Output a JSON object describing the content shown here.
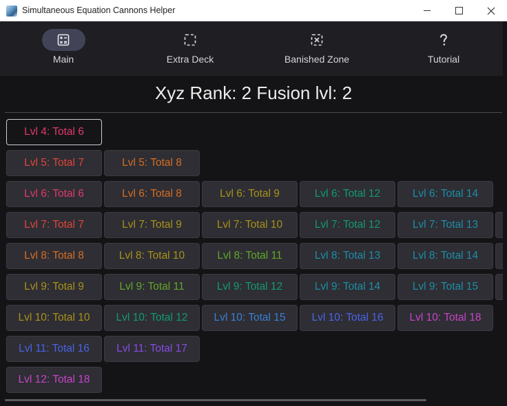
{
  "window": {
    "title": "Simultaneous Equation Cannons Helper"
  },
  "nav": [
    {
      "label": "Main",
      "icon": "calculator-icon"
    },
    {
      "label": "Extra Deck",
      "icon": "dashed-square-icon"
    },
    {
      "label": "Banished Zone",
      "icon": "dashed-square-x-icon"
    },
    {
      "label": "Tutorial",
      "icon": "question-mark-icon"
    }
  ],
  "heading": "Xyz Rank: 2 Fusion lvl: 2",
  "colors": {
    "crimson": "#e03a6a",
    "red": "#e2453a",
    "orange": "#d66e25",
    "olive": "#a9911a",
    "green": "#63a62a",
    "teal": "#139a70",
    "cyan": "#1d8ea7",
    "blue": "#3b7fd5",
    "indigo": "#4b63e6",
    "violet": "#8a4be3",
    "magenta": "#c844c8"
  },
  "rows": [
    [
      {
        "text": "Lvl 4: Total 6",
        "color": "#e03a6a",
        "selected": true
      }
    ],
    [
      {
        "text": "Lvl 5: Total 7",
        "color": "#e2453a"
      },
      {
        "text": "Lvl 5: Total 8",
        "color": "#d66e25"
      }
    ],
    [
      {
        "text": "Lvl 6: Total 6",
        "color": "#e03a6a"
      },
      {
        "text": "Lvl 6: Total 8",
        "color": "#d66e25"
      },
      {
        "text": "Lvl 6: Total 9",
        "color": "#a9911a"
      },
      {
        "text": "Lvl 6: Total 12",
        "color": "#139a70"
      },
      {
        "text": "Lvl 6: Total 14",
        "color": "#1d8ea7"
      }
    ],
    [
      {
        "text": "Lvl 7: Total 7",
        "color": "#e2453a"
      },
      {
        "text": "Lvl 7: Total 9",
        "color": "#a9911a"
      },
      {
        "text": "Lvl 7: Total 10",
        "color": "#a9911a"
      },
      {
        "text": "Lvl 7: Total 12",
        "color": "#139a70"
      },
      {
        "text": "Lvl 7: Total 13",
        "color": "#1d8ea7"
      }
    ],
    [
      {
        "text": "Lvl 8: Total 8",
        "color": "#d66e25"
      },
      {
        "text": "Lvl 8: Total 10",
        "color": "#a9911a"
      },
      {
        "text": "Lvl 8: Total 11",
        "color": "#63a62a"
      },
      {
        "text": "Lvl 8: Total 13",
        "color": "#1d8ea7"
      },
      {
        "text": "Lvl 8: Total 14",
        "color": "#1d8ea7"
      }
    ],
    [
      {
        "text": "Lvl 9: Total 9",
        "color": "#a9911a"
      },
      {
        "text": "Lvl 9: Total 11",
        "color": "#63a62a"
      },
      {
        "text": "Lvl 9: Total 12",
        "color": "#139a70"
      },
      {
        "text": "Lvl 9: Total 14",
        "color": "#1d8ea7"
      },
      {
        "text": "Lvl 9: Total 15",
        "color": "#1d8ea7"
      }
    ],
    [
      {
        "text": "Lvl 10: Total 10",
        "color": "#a9911a"
      },
      {
        "text": "Lvl 10: Total 12",
        "color": "#139a70"
      },
      {
        "text": "Lvl 10: Total 15",
        "color": "#3b7fd5"
      },
      {
        "text": "Lvl 10: Total 16",
        "color": "#4b63e6"
      },
      {
        "text": "Lvl 10: Total 18",
        "color": "#c844c8"
      }
    ],
    [
      {
        "text": "Lvl 11: Total 16",
        "color": "#4b63e6"
      },
      {
        "text": "Lvl 11: Total 17",
        "color": "#8a4be3"
      }
    ],
    [
      {
        "text": "Lvl 12: Total 18",
        "color": "#c844c8"
      }
    ]
  ],
  "rows_with_overflow": [
    3,
    4,
    5
  ]
}
